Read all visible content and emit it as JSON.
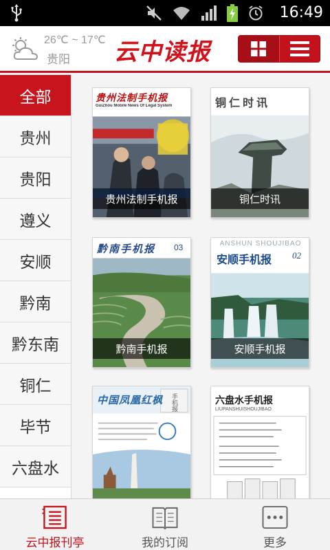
{
  "status_bar": {
    "time": "16:49"
  },
  "header": {
    "weather": {
      "temp": "26℃ ~ 17℃",
      "city": "贵阳",
      "icon": "partly-cloudy-icon"
    },
    "logo": "云中读报",
    "view_modes": [
      "grid-view-icon",
      "list-view-icon"
    ],
    "accent_color": "#c4121c"
  },
  "sidebar": {
    "items": [
      {
        "label": "全部",
        "active": true
      },
      {
        "label": "贵州"
      },
      {
        "label": "贵阳"
      },
      {
        "label": "遵义"
      },
      {
        "label": "安顺"
      },
      {
        "label": "黔南"
      },
      {
        "label": "黔东南"
      },
      {
        "label": "铜仁"
      },
      {
        "label": "毕节"
      },
      {
        "label": "六盘水"
      }
    ]
  },
  "publications": [
    {
      "name": "贵州法制手机报",
      "masthead": "贵州法制手机报",
      "masthead_sub": "GuiZhou Mobile News Of Legal System"
    },
    {
      "name": "铜仁时讯",
      "masthead": "铜仁时讯"
    },
    {
      "name": "黔南手机报",
      "masthead": "黔南手机报",
      "issue": "03"
    },
    {
      "name": "安顺手机报",
      "masthead": "安顺手机报",
      "masthead_sub": "ANSHUN SHOUJIBAO",
      "issue": "02"
    },
    {
      "name": "",
      "masthead": "中国凤凰红枫",
      "masthead_side": "手机报"
    },
    {
      "name": "",
      "masthead": "六盘水手机报",
      "masthead_sub": "LIUPANSHUISHOUJIBAO"
    }
  ],
  "tabbar": {
    "tabs": [
      {
        "label": "云中报刊亭",
        "icon": "newsstand-icon",
        "active": true
      },
      {
        "label": "我的订阅",
        "icon": "book-icon"
      },
      {
        "label": "更多",
        "icon": "more-icon"
      }
    ]
  }
}
